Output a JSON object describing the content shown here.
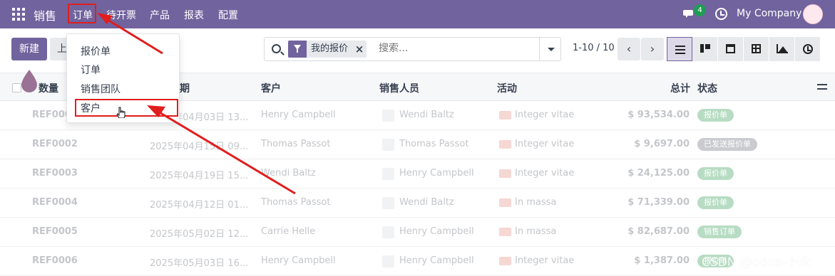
{
  "navbar": {
    "app_name": "销售",
    "menu": [
      "订单",
      "待开票",
      "产品",
      "报表",
      "配置"
    ],
    "chat_badge": "4",
    "company": "My Company"
  },
  "control": {
    "new_label": "新建",
    "upload_label": "上",
    "facet_label": "我的报价",
    "search_placeholder": "搜索...",
    "pager": "1-10 / 10",
    "prev": "‹",
    "next": "›"
  },
  "dropdown": {
    "items": [
      "报价单",
      "订单",
      "销售团队",
      "客户"
    ]
  },
  "table": {
    "headers": {
      "number": "数量",
      "date": "期",
      "customer": "客户",
      "salesperson": "销售人员",
      "activity": "活动",
      "total": "总计",
      "status": "状态"
    },
    "rows": [
      {
        "ref": "REF0001",
        "date": "2025年04月03日 13...",
        "customer": "Henry Campbell",
        "salesperson": "Wendi Baltz",
        "activity": "Integer vitae",
        "total": "$ 93,534.00",
        "status": "报价单",
        "status_color": "#b7dcc3"
      },
      {
        "ref": "REF0002",
        "date": "2025年04月15日 09...",
        "customer": "Thomas Passot",
        "salesperson": "Thomas Passot",
        "activity": "Integer vitae",
        "total": "$ 9,697.00",
        "status": "已发送报价单",
        "status_color": "#c9cbcf"
      },
      {
        "ref": "REF0003",
        "date": "2025年04月19日 15...",
        "customer": "Wendi Baltz",
        "salesperson": "Henry Campbell",
        "activity": "Integer vitae",
        "total": "$ 24,125.00",
        "status": "报价单",
        "status_color": "#b7dcc3"
      },
      {
        "ref": "REF0004",
        "date": "2025年04月12日 01...",
        "customer": "Thomas Passot",
        "salesperson": "Wendi Baltz",
        "activity": "In massa",
        "total": "$ 71,339.00",
        "status": "报价单",
        "status_color": "#b7dcc3"
      },
      {
        "ref": "REF0005",
        "date": "2025年05月02日 12...",
        "customer": "Carrie Helle",
        "salesperson": "Henry Campbell",
        "activity": "In massa",
        "total": "$ 82,687.00",
        "status": "销售订单",
        "status_color": "#b7dcc3"
      },
      {
        "ref": "REF0006",
        "date": "2025年05月03日 16...",
        "customer": "Henry Campbell",
        "salesperson": "Henry Campbell",
        "activity": "Integer vitae",
        "total": "$ 1,387.00",
        "status": "报价单",
        "status_color": "#b7dcc3"
      }
    ]
  },
  "watermark": "CSDN @odoo-卜永",
  "colors": {
    "brand": "#71639e",
    "annotation": "#e01e1e"
  }
}
